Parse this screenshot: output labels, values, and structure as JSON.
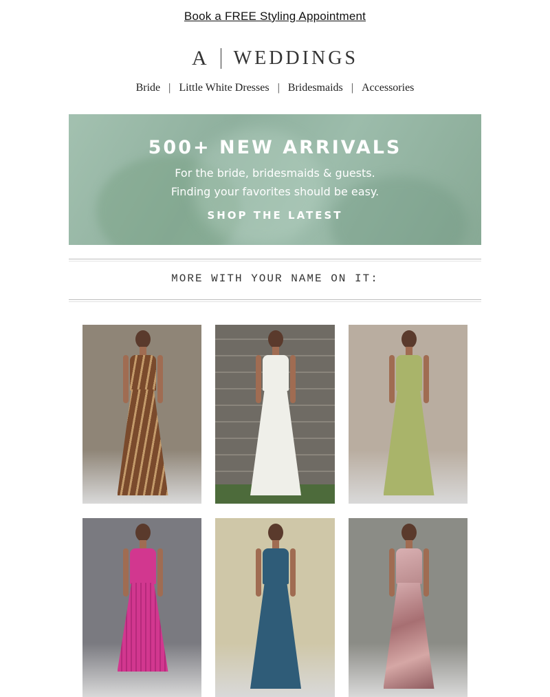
{
  "top_link": "Book a FREE Styling Appointment",
  "logo": {
    "letter": "A",
    "brand": "WEDDINGS"
  },
  "nav": [
    "Bride",
    "Little White Dresses",
    "Bridesmaids",
    "Accessories"
  ],
  "nav_separator": "|",
  "hero": {
    "title": "500+ NEW ARRIVALS",
    "line1": "For the bride, bridesmaids & guests.",
    "line2": "Finding your favorites should be easy.",
    "cta": "SHOP THE LATEST"
  },
  "section_title": "MORE WITH YOUR NAME ON IT:",
  "products": [
    {
      "name": "brown-patterned-maxi-dress",
      "bg": "#8f8577",
      "dress": "#7a4a2c"
    },
    {
      "name": "white-strapless-column-gown",
      "bg": "#7b776f",
      "dress": "#efefe9"
    },
    {
      "name": "sage-green-satin-slip-gown",
      "bg": "#b9ada0",
      "dress": "#a9b46a"
    },
    {
      "name": "magenta-pleated-midi-dress",
      "bg": "#7a7a80",
      "dress": "#d2378f"
    },
    {
      "name": "teal-strapless-satin-gown",
      "bg": "#cfc7a8",
      "dress": "#2f5c78"
    },
    {
      "name": "pink-sequin-one-shoulder-dress",
      "bg": "#8b8c86",
      "dress": "#c89c9c"
    }
  ]
}
